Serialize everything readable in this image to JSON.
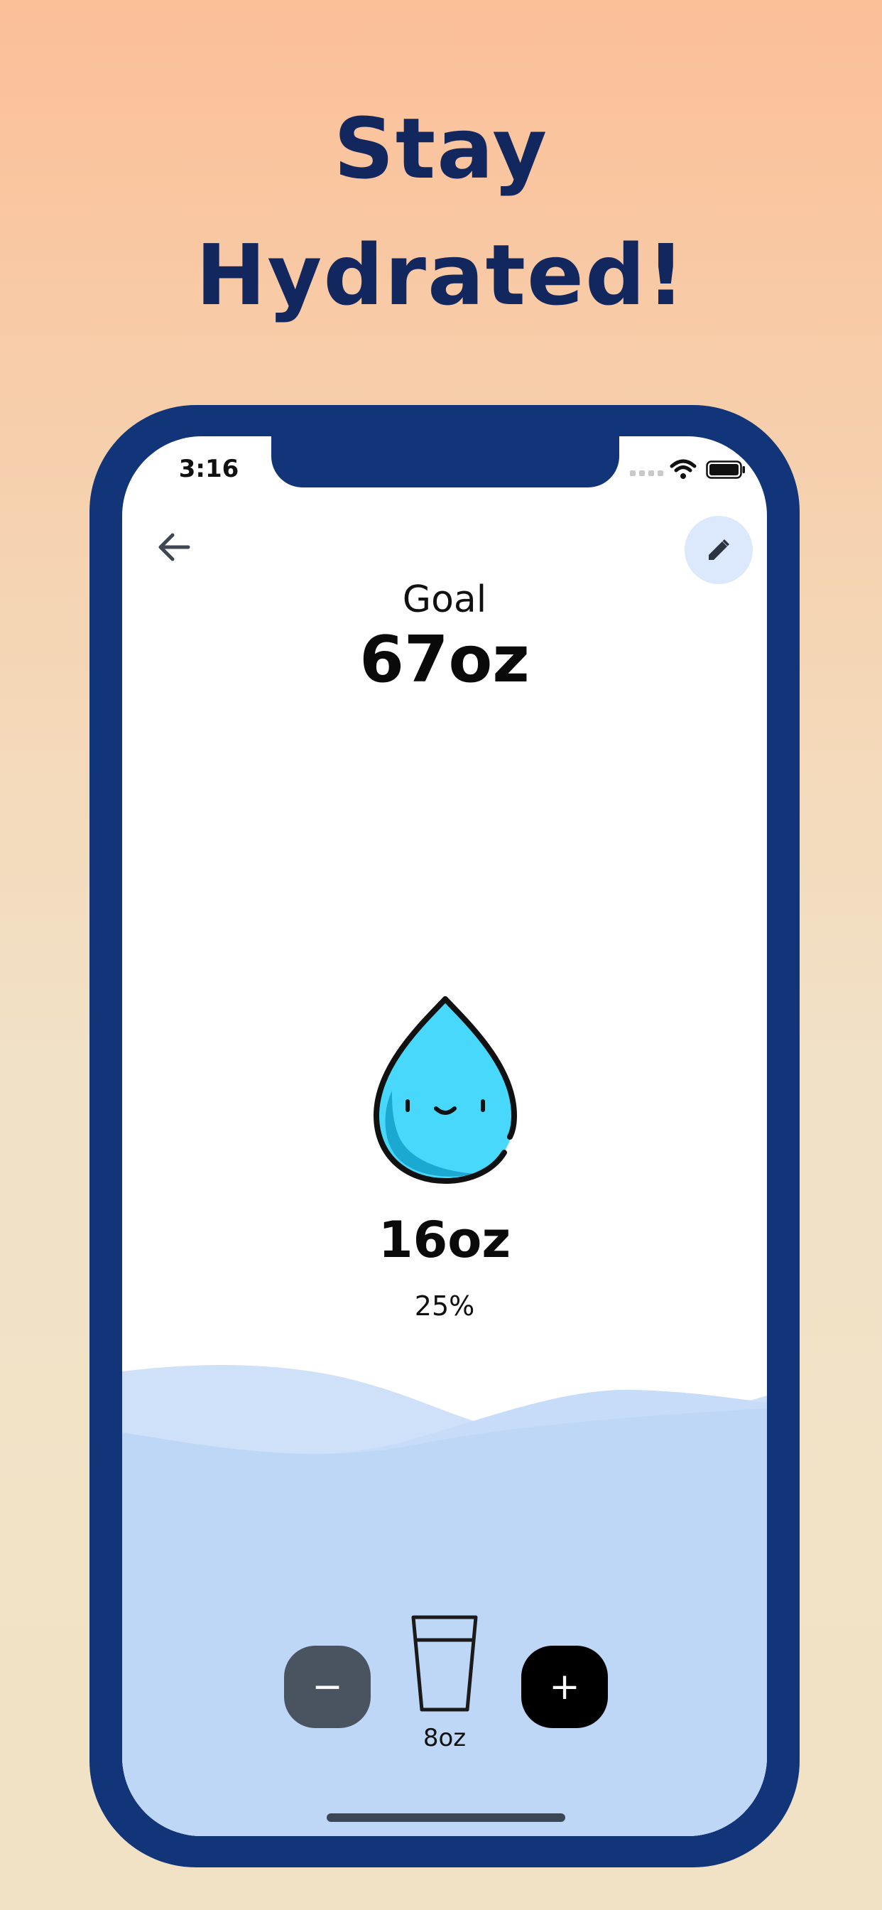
{
  "headline": {
    "line1": "Stay",
    "line2": "Hydrated!"
  },
  "status_bar": {
    "time": "3:16"
  },
  "header": {
    "back_icon": "arrow-left-icon",
    "edit_icon": "pencil-icon"
  },
  "goal": {
    "label": "Goal",
    "value": "67oz"
  },
  "progress": {
    "amount": "16oz",
    "percent": "25%",
    "fraction": 0.25
  },
  "controls": {
    "decrement": "−",
    "increment": "+",
    "serving_size": "8oz",
    "glass_icon": "glass-icon"
  },
  "colors": {
    "headline": "#13275f",
    "phone_frame": "#12357a",
    "drop": "#48d8fc",
    "wave": "#bfd7f6",
    "edit_button_bg": "#dce8fb"
  }
}
